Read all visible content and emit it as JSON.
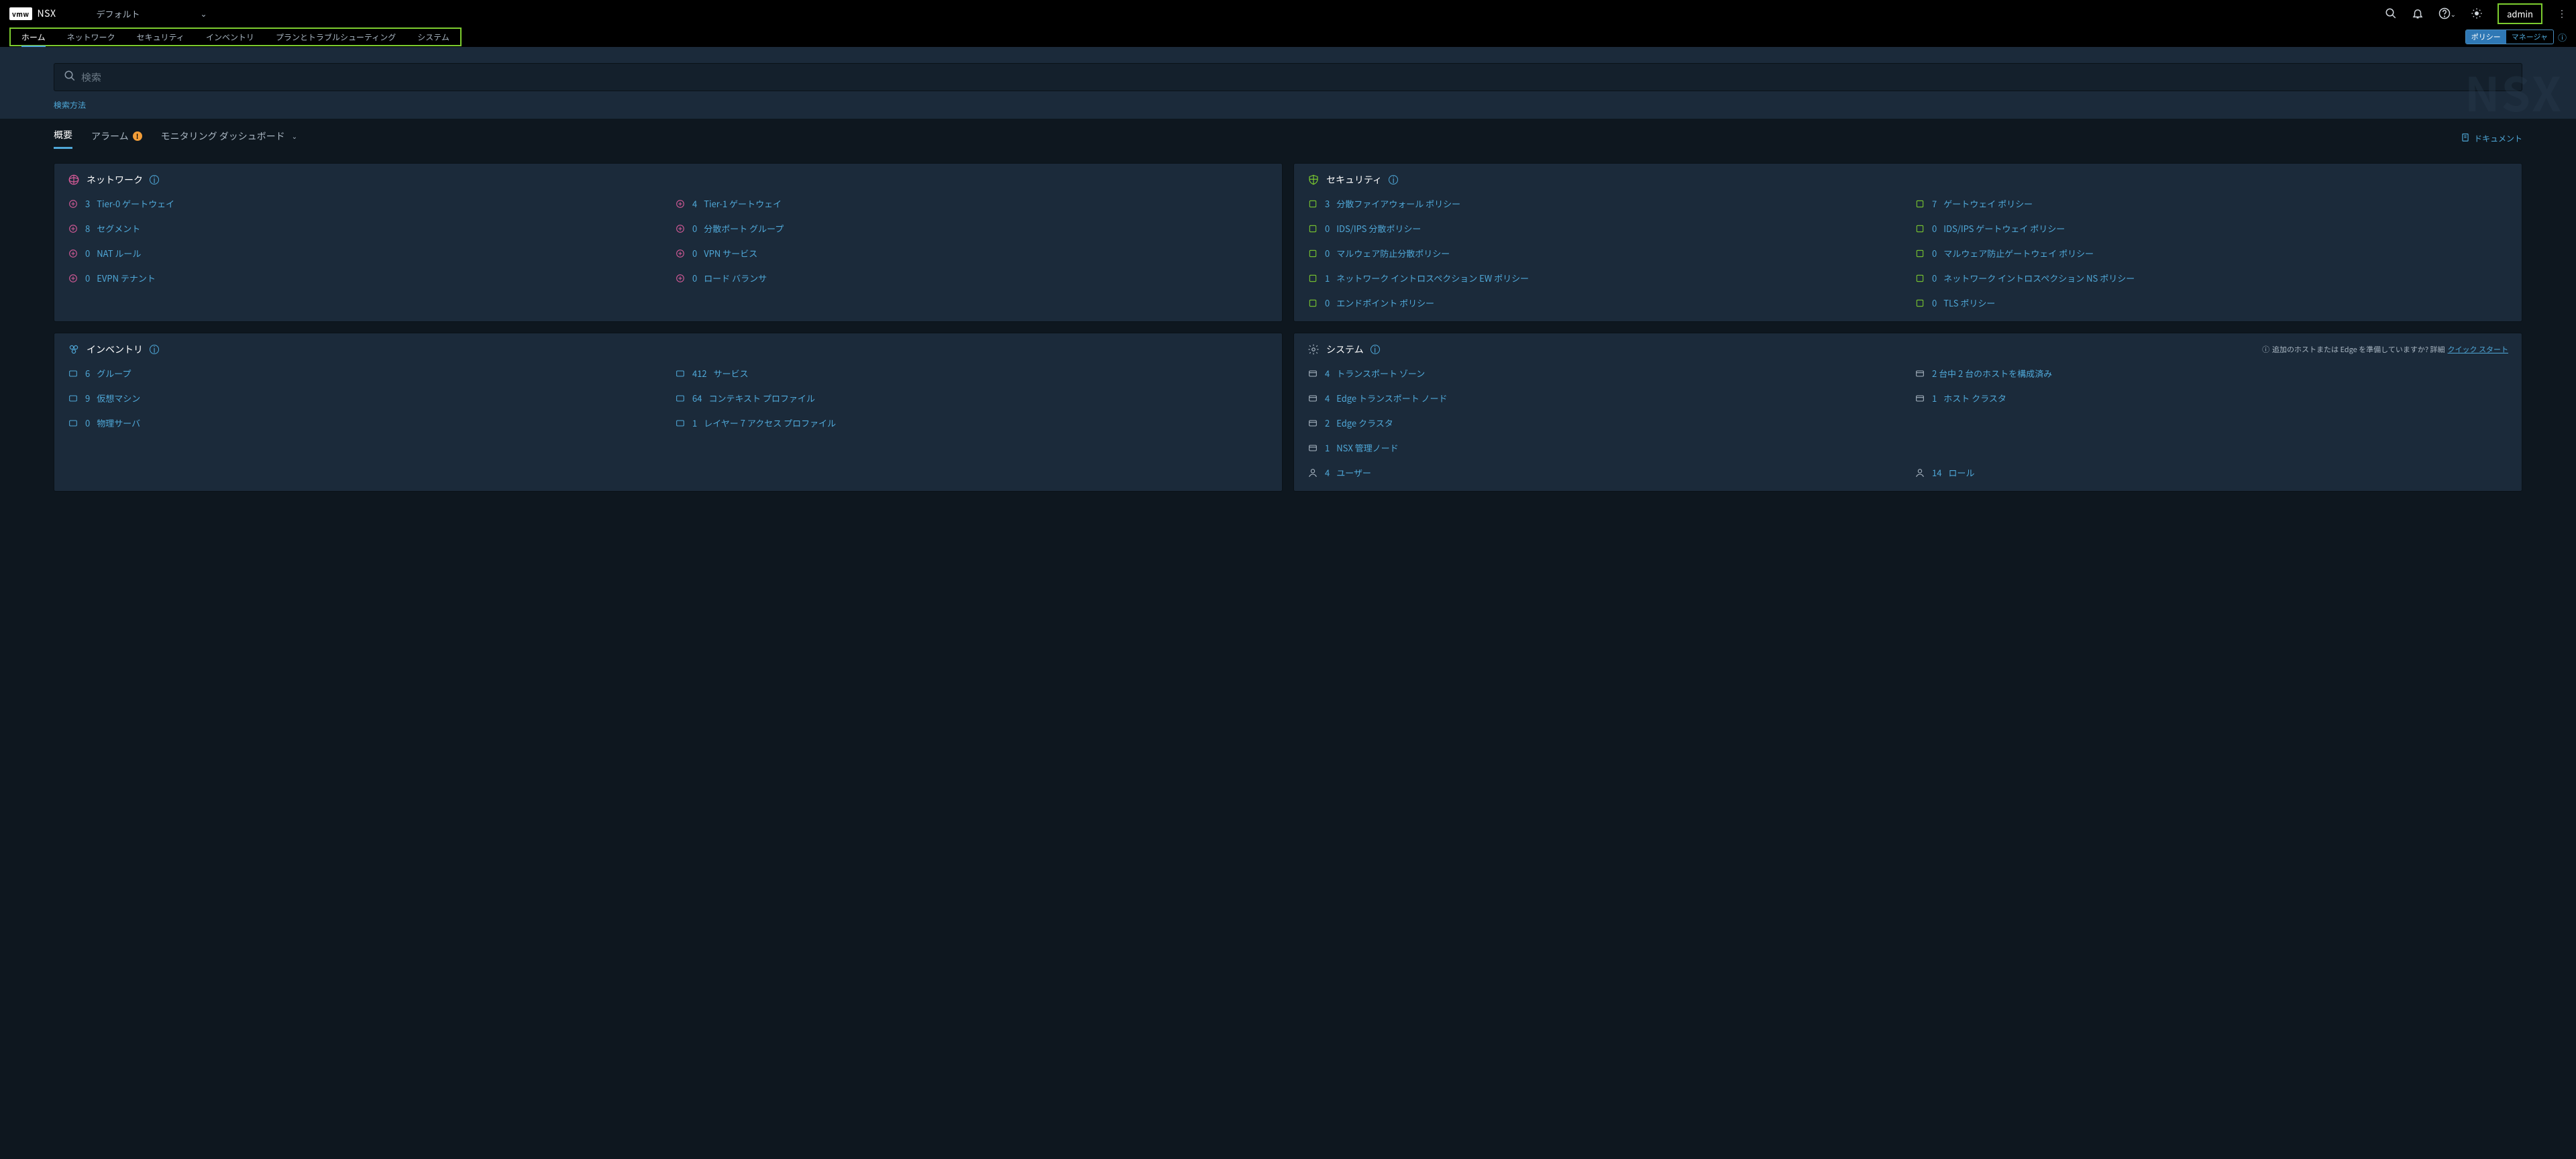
{
  "header": {
    "logo_badge": "vmw",
    "product": "NSX",
    "tenant": "デフォルト",
    "user": "admin"
  },
  "nav": {
    "items": [
      "ホーム",
      "ネットワーク",
      "セキュリティ",
      "インベントリ",
      "プランとトラブルシューティング",
      "システム"
    ],
    "mode_policy": "ポリシー",
    "mode_manager": "マネージャ"
  },
  "search": {
    "placeholder": "検索",
    "help": "検索方法",
    "background_text": "NSX"
  },
  "subtabs": {
    "overview": "概要",
    "alarms": "アラーム",
    "monitoring": "モニタリング ダッシュボード",
    "document": "ドキュメント"
  },
  "cards": {
    "network": {
      "title": "ネットワーク",
      "items_left": [
        {
          "count": "3",
          "label": "Tier-0 ゲートウェイ"
        },
        {
          "count": "8",
          "label": "セグメント"
        },
        {
          "count": "0",
          "label": "NAT ルール"
        },
        {
          "count": "0",
          "label": "EVPN テナント"
        }
      ],
      "items_right": [
        {
          "count": "4",
          "label": "Tier-1 ゲートウェイ"
        },
        {
          "count": "0",
          "label": "分散ポート グループ"
        },
        {
          "count": "0",
          "label": "VPN サービス"
        },
        {
          "count": "0",
          "label": "ロード バランサ"
        }
      ]
    },
    "security": {
      "title": "セキュリティ",
      "items_left": [
        {
          "count": "3",
          "label": "分散ファイアウォール ポリシー"
        },
        {
          "count": "0",
          "label": "IDS/IPS 分散ポリシー"
        },
        {
          "count": "0",
          "label": "マルウェア防止分散ポリシー"
        },
        {
          "count": "1",
          "label": "ネットワーク イントロスペクション EW ポリシー"
        },
        {
          "count": "0",
          "label": "エンドポイント ポリシー"
        }
      ],
      "items_right": [
        {
          "count": "7",
          "label": "ゲートウェイ ポリシー"
        },
        {
          "count": "0",
          "label": "IDS/IPS ゲートウェイ ポリシー"
        },
        {
          "count": "0",
          "label": "マルウェア防止ゲートウェイ ポリシー"
        },
        {
          "count": "0",
          "label": "ネットワーク イントロスペクション NS ポリシー"
        },
        {
          "count": "0",
          "label": "TLS ポリシー"
        }
      ]
    },
    "inventory": {
      "title": "インベントリ",
      "items_left": [
        {
          "count": "6",
          "label": "グループ"
        },
        {
          "count": "9",
          "label": "仮想マシン"
        },
        {
          "count": "0",
          "label": "物理サーバ"
        }
      ],
      "items_right": [
        {
          "count": "412",
          "label": "サービス"
        },
        {
          "count": "64",
          "label": "コンテキスト プロファイル"
        },
        {
          "count": "1",
          "label": "レイヤー 7 アクセス プロファイル"
        }
      ]
    },
    "system": {
      "title": "システム",
      "prepare_note_prefix": "追加のホストまたは Edge を準備していますか? 詳細",
      "prepare_note_link": "クイック スタート",
      "items_left": [
        {
          "count": "4",
          "label": "トランスポート ゾーン"
        },
        {
          "count": "4",
          "label": "Edge トランスポート ノード"
        },
        {
          "count": "2",
          "label": "Edge クラスタ"
        },
        {
          "count": "1",
          "label": "NSX 管理ノード"
        },
        {
          "count": "4",
          "label": "ユーザー"
        }
      ],
      "items_right": [
        {
          "count": "",
          "label": "2 台中 2 台のホストを構成済み"
        },
        {
          "count": "1",
          "label": "ホスト クラスタ"
        },
        {
          "count": "",
          "label": ""
        },
        {
          "count": "",
          "label": ""
        },
        {
          "count": "14",
          "label": "ロール"
        }
      ]
    }
  }
}
